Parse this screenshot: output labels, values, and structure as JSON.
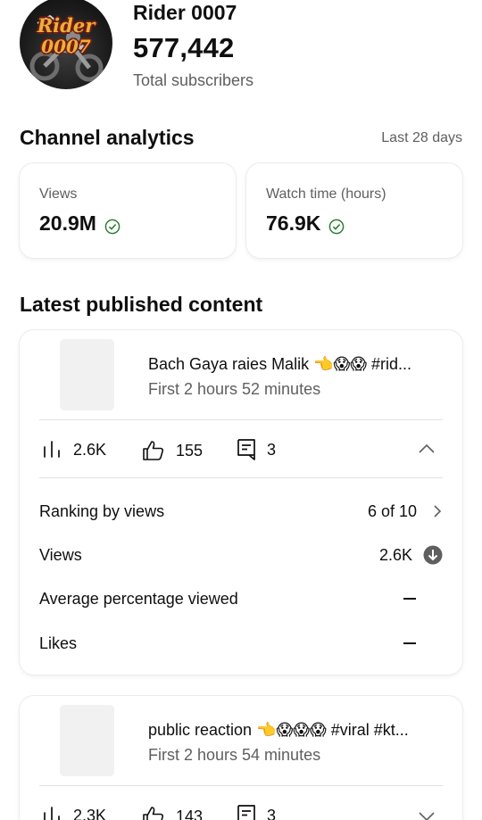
{
  "channel": {
    "avatar_text_line1": "Rider",
    "avatar_text_line2": "0007",
    "name": "Rider 0007",
    "subscribers": "577,442",
    "subscribers_label": "Total subscribers"
  },
  "analytics": {
    "title": "Channel analytics",
    "period": "Last 28 days",
    "metrics": [
      {
        "label": "Views",
        "value": "20.9M",
        "icon": "check-circle-icon"
      },
      {
        "label": "Watch time (hours)",
        "value": "76.9K",
        "icon": "check-circle-icon"
      }
    ]
  },
  "latest": {
    "title": "Latest published content",
    "videos": [
      {
        "title": "Bach  Gaya raies Malik 👈😱😱 #rid...",
        "subtitle": "First 2 hours 52 minutes",
        "views": "2.6K",
        "likes": "155",
        "comments": "3",
        "expanded": true,
        "details": {
          "ranking_label": "Ranking by views",
          "ranking_value": "6 of 10",
          "views_label": "Views",
          "views_value": "2.6K",
          "avg_label": "Average percentage viewed",
          "likes_label": "Likes"
        }
      },
      {
        "title": "public reaction 👈😱😱😱 #viral #kt...",
        "subtitle": "First 2 hours 54 minutes",
        "views": "2.3K",
        "likes": "143",
        "comments": "3",
        "expanded": false
      }
    ]
  },
  "colors": {
    "accent_green": "#2e7d32",
    "text_primary": "#0f0f0f",
    "text_secondary": "#5f5f5f",
    "thumb_placeholder": "#f1f1f1"
  }
}
